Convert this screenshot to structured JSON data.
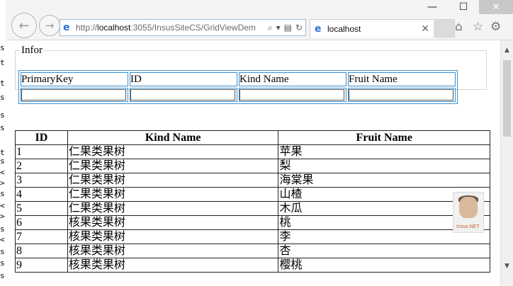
{
  "browser": {
    "address": {
      "scheme": "http://",
      "host": "localhost",
      "rest": ":3055/InsusSiteCS/GridViewDem"
    },
    "tab_title": "localhost",
    "window_buttons": [
      "—",
      "☐",
      "✕"
    ]
  },
  "editor_behind": [
    "s",
    "t",
    "t",
    "s",
    "s",
    "s",
    "t",
    "s",
    "<",
    ">",
    "s",
    "<",
    ">",
    "s",
    "<",
    "s",
    "s",
    "s"
  ],
  "infor": {
    "legend": "Infor",
    "headers": [
      "PrimaryKey",
      "ID",
      "Kind Name",
      "Fruit Name"
    ],
    "values": [
      "",
      "",
      "",
      ""
    ]
  },
  "grid": {
    "headers": [
      "ID",
      "Kind Name",
      "Fruit Name"
    ],
    "rows": [
      [
        "1",
        "仁果类果树",
        "苹果"
      ],
      [
        "2",
        "仁果类果树",
        "梨"
      ],
      [
        "3",
        "仁果类果树",
        "海棠果"
      ],
      [
        "4",
        "仁果类果树",
        "山楂"
      ],
      [
        "5",
        "仁果类果树",
        "木瓜"
      ],
      [
        "6",
        "核果类果树",
        "桃"
      ],
      [
        "7",
        "核果类果树",
        "李"
      ],
      [
        "8",
        "核果类果树",
        "杏"
      ],
      [
        "9",
        "核果类果树",
        "樱桃"
      ]
    ]
  },
  "watermark": {
    "brand": "Insus.NET"
  },
  "icons": [
    "back-arrow-icon",
    "forward-arrow-icon",
    "ie-logo-icon",
    "search-icon",
    "compat-view-icon",
    "refresh-icon",
    "home-icon",
    "favorites-star-icon",
    "settings-gear-icon"
  ]
}
